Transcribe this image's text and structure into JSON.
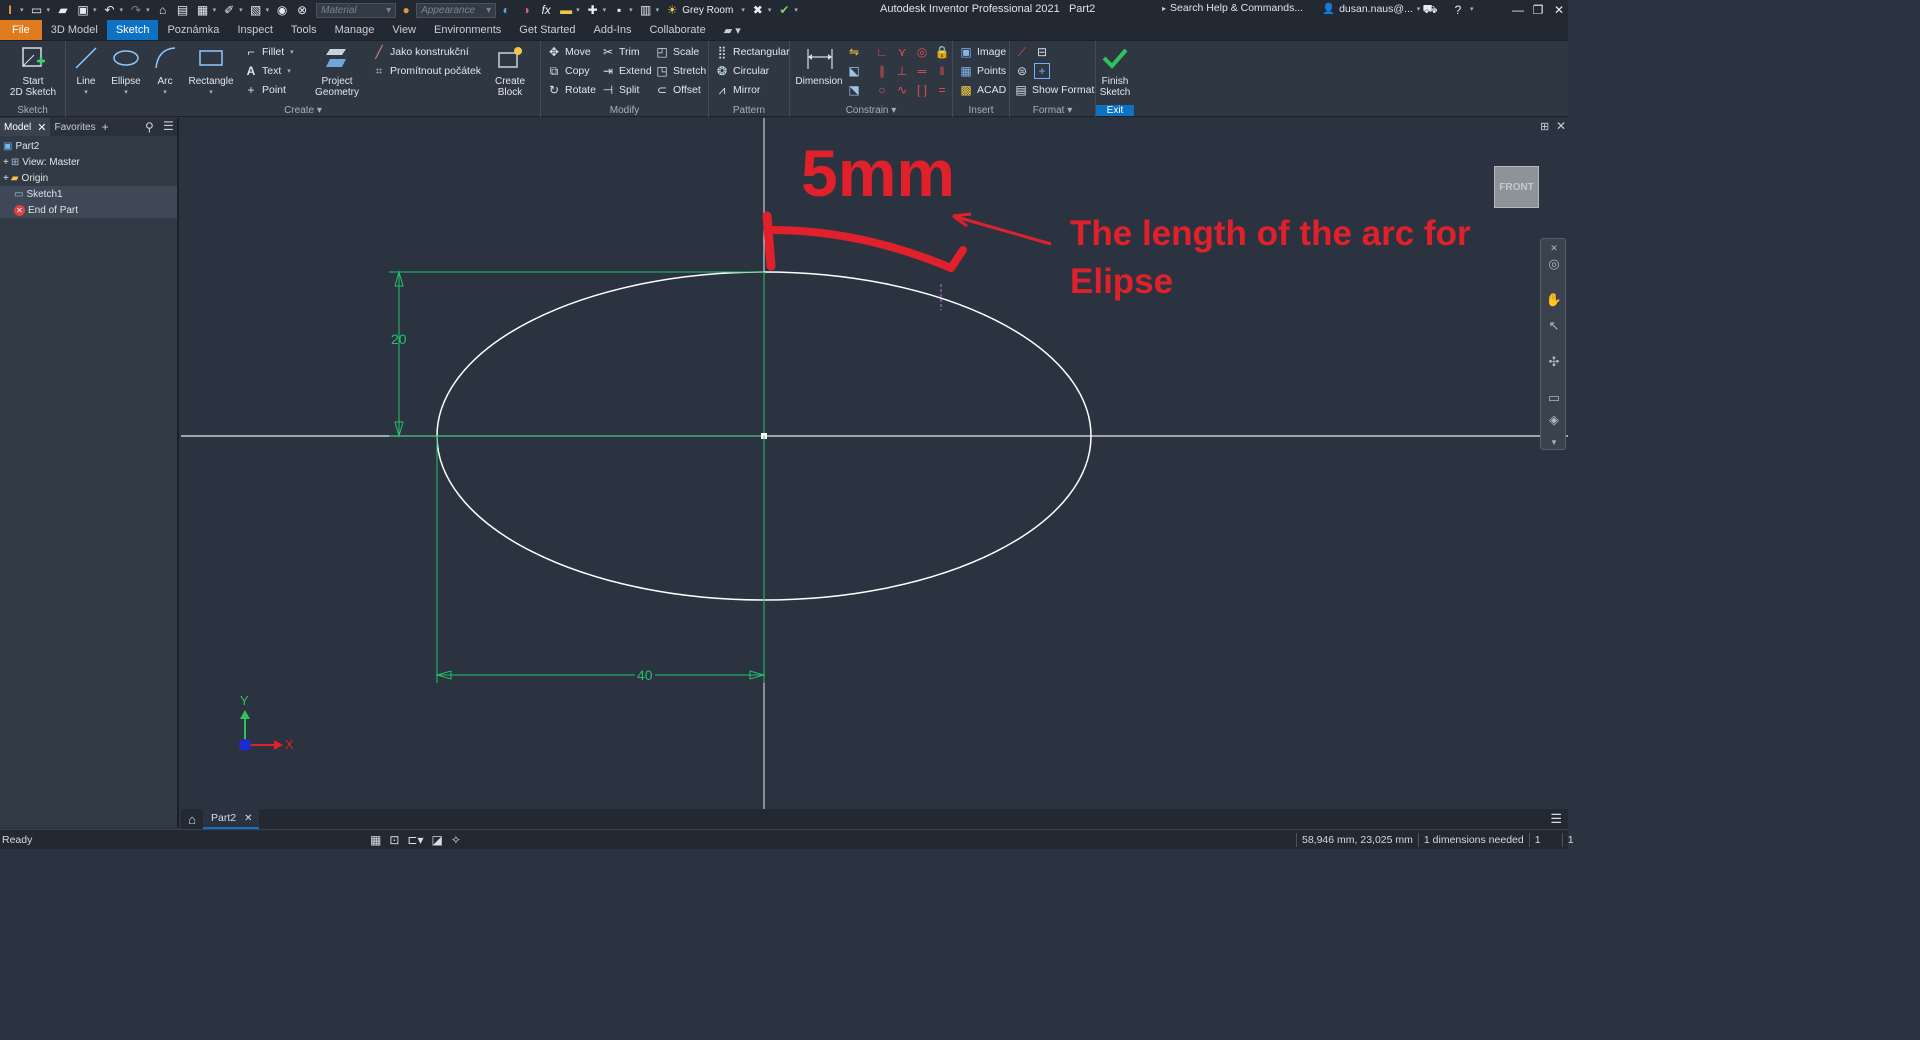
{
  "app": {
    "title": "Autodesk Inventor Professional 2021",
    "doc_name": "Part2",
    "search_placeholder": "Search Help & Commands...",
    "user": "dusan.naus@...",
    "material_placeholder": "Material",
    "appearance_placeholder": "Appearance",
    "lighting": "Grey Room"
  },
  "tabs": [
    "File",
    "3D Model",
    "Sketch",
    "Poznámka",
    "Inspect",
    "Tools",
    "Manage",
    "View",
    "Environments",
    "Get Started",
    "Add-Ins",
    "Collaborate"
  ],
  "ribbon": {
    "sketch_panel": {
      "title": "Sketch",
      "start_label": "Start\n2D Sketch"
    },
    "create_panel": {
      "title": "Create",
      "line": "Line",
      "ellipse": "Ellipse",
      "arc": "Arc",
      "rectangle": "Rectangle",
      "fillet": "Fillet",
      "text": "Text",
      "point": "Point",
      "project_geometry": "Project\nGeometry",
      "jako": "Jako  konstrukční",
      "promitnout": "Promítnout  počátek",
      "create_block": "Create Block"
    },
    "modify_panel": {
      "title": "Modify",
      "move": "Move",
      "copy": "Copy",
      "rotate": "Rotate",
      "trim": "Trim",
      "extend": "Extend",
      "split": "Split",
      "scale": "Scale",
      "stretch": "Stretch",
      "offset": "Offset"
    },
    "pattern_panel": {
      "title": "Pattern",
      "rectangular": "Rectangular",
      "circular": "Circular",
      "mirror": "Mirror"
    },
    "constrain_panel": {
      "title": "Constrain",
      "dimension": "Dimension"
    },
    "insert_panel": {
      "title": "Insert",
      "image": "Image",
      "points": "Points",
      "acad": "ACAD"
    },
    "format_panel": {
      "title": "Format",
      "show_format": "Show Format"
    },
    "exit_panel": {
      "title": "Exit",
      "finish": "Finish\nSketch"
    }
  },
  "browser": {
    "tab_model": "Model",
    "tab_favorites": "Favorites",
    "items": [
      "Part2",
      "View: Master",
      "Origin",
      "Sketch1",
      "End of Part"
    ]
  },
  "canvas": {
    "viewcube_label": "FRONT",
    "dim_vertical": "20",
    "dim_horizontal": "40",
    "annotation_big": "5mm",
    "annotation_line1": "The length of the arc for",
    "annotation_line2": "Elipse",
    "axis_x": "X",
    "axis_y": "Y"
  },
  "doc_tab": "Part2",
  "status": {
    "ready": "Ready",
    "coords": "58,946 mm, 23,025 mm",
    "dims": "1 dimensions needed",
    "c1": "1",
    "c2": "1"
  },
  "colors": {
    "accent": "#0e72c4",
    "file_tab": "#e07b1f",
    "annotation_red": "#e0202a",
    "dim_green": "#22c06a",
    "finish_green": "#2fc25b"
  }
}
